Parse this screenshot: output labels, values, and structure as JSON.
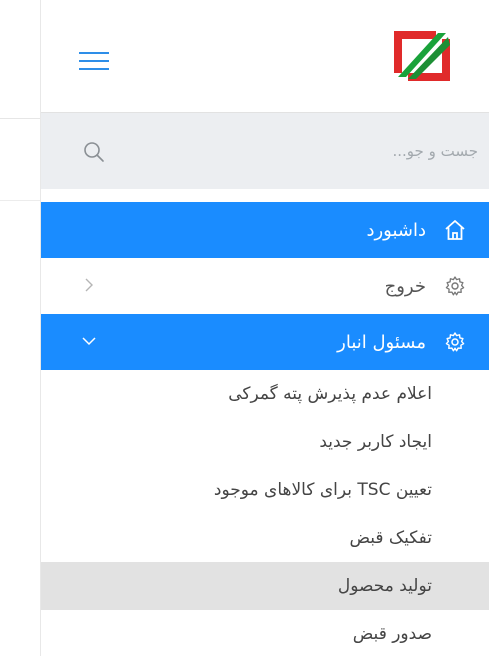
{
  "search": {
    "placeholder": "جست و جو..."
  },
  "menu": {
    "dashboard": {
      "label": "داشبورد"
    },
    "logout": {
      "label": "خروج"
    },
    "warehouse": {
      "label": "مسئول انبار",
      "items": [
        "اعلام عدم پذیرش پته گمرکی",
        "ایجاد کاربر جدید",
        "تعیین TSC برای کالاهای موجود",
        "تفکیک قبض",
        "تولید محصول",
        "صدور قبض"
      ]
    }
  },
  "colors": {
    "accent": "#1a8cff",
    "hamburger": "#2e8ee8",
    "logo_green": "#19a23a",
    "logo_red": "#e02a2a",
    "hover_row": "#e2e2e2"
  },
  "icons": {
    "hamburger": "menu-icon",
    "search": "search-icon",
    "dashboard": "home-icon",
    "settings": "gear-icon",
    "collapsed": "chevron-right-icon",
    "expanded": "chevron-down-icon"
  }
}
